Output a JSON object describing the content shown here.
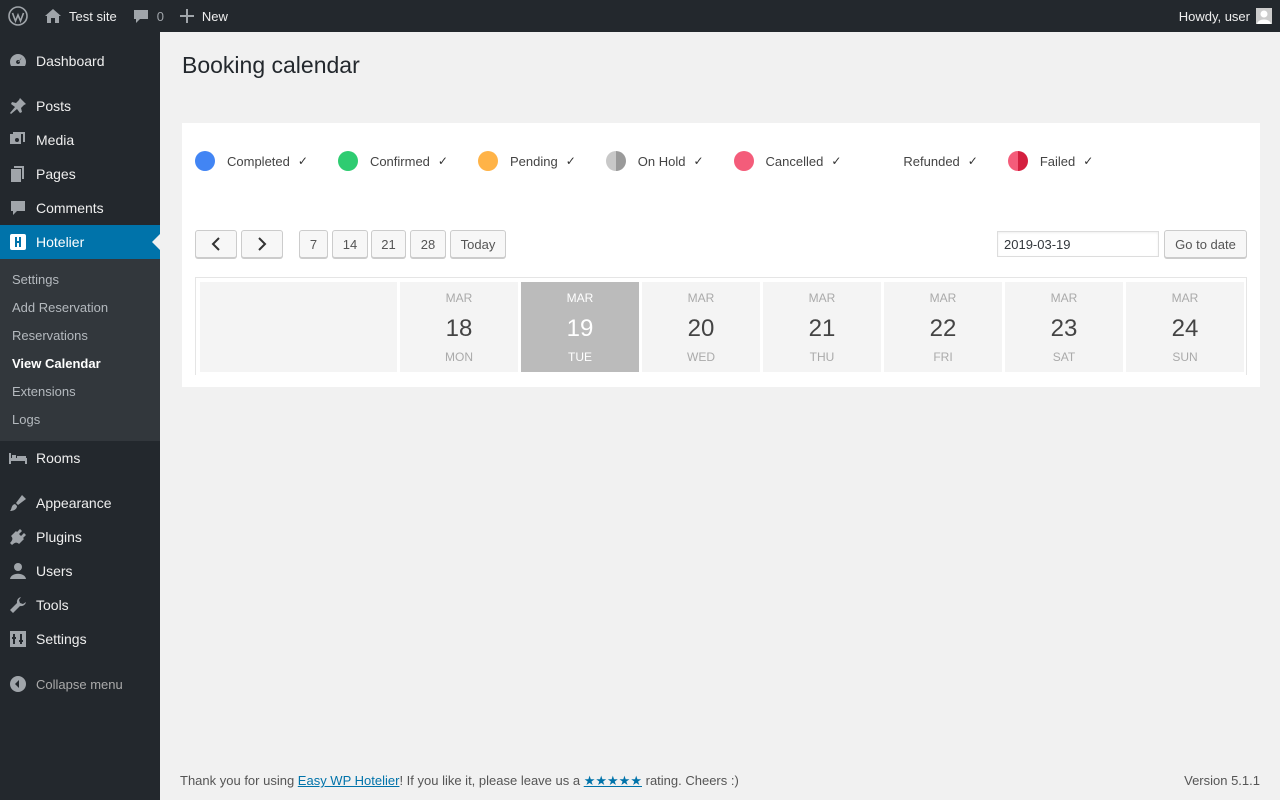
{
  "adminbar": {
    "site_name": "Test site",
    "comments_count": "0",
    "new_label": "New",
    "greeting": "Howdy, user"
  },
  "sidebar": {
    "items": [
      {
        "label": "Dashboard",
        "icon": "dashboard-icon"
      },
      {
        "label": "Posts",
        "icon": "pin-icon"
      },
      {
        "label": "Media",
        "icon": "media-icon"
      },
      {
        "label": "Pages",
        "icon": "pages-icon"
      },
      {
        "label": "Comments",
        "icon": "comment-icon"
      },
      {
        "label": "Hotelier",
        "icon": "hotelier-icon"
      },
      {
        "label": "Rooms",
        "icon": "bed-icon"
      },
      {
        "label": "Appearance",
        "icon": "brush-icon"
      },
      {
        "label": "Plugins",
        "icon": "plug-icon"
      },
      {
        "label": "Users",
        "icon": "user-icon"
      },
      {
        "label": "Tools",
        "icon": "wrench-icon"
      },
      {
        "label": "Settings",
        "icon": "settings-icon"
      }
    ],
    "submenu": [
      "Settings",
      "Add Reservation",
      "Reservations",
      "View Calendar",
      "Extensions",
      "Logs"
    ],
    "collapse_label": "Collapse menu"
  },
  "page": {
    "title": "Booking calendar"
  },
  "legend": [
    {
      "label": "Completed",
      "color": "#4285f4",
      "type": "solid",
      "check": "✓"
    },
    {
      "label": "Confirmed",
      "color": "#2ecc71",
      "type": "solid",
      "check": "✓"
    },
    {
      "label": "Pending",
      "color": "#ffb347",
      "type": "solid",
      "check": "✓"
    },
    {
      "label": "On Hold",
      "color": "#a6a6a6",
      "type": "half",
      "check": "✓"
    },
    {
      "label": "Cancelled",
      "color": "#f45c7a",
      "type": "solid",
      "check": "✓"
    },
    {
      "label": "Refunded",
      "color": "",
      "type": "none",
      "check": "✓"
    },
    {
      "label": "Failed",
      "color": "#f0264c",
      "type": "half-red",
      "check": "✓"
    }
  ],
  "toolbar": {
    "ranges": [
      "7",
      "14",
      "21",
      "28"
    ],
    "today_label": "Today",
    "date_value": "2019-03-19",
    "goto_label": "Go to date"
  },
  "calendar": {
    "days": [
      {
        "month": "MAR",
        "day": "18",
        "weekday": "MON",
        "today": false
      },
      {
        "month": "MAR",
        "day": "19",
        "weekday": "TUE",
        "today": true
      },
      {
        "month": "MAR",
        "day": "20",
        "weekday": "WED",
        "today": false
      },
      {
        "month": "MAR",
        "day": "21",
        "weekday": "THU",
        "today": false
      },
      {
        "month": "MAR",
        "day": "22",
        "weekday": "FRI",
        "today": false
      },
      {
        "month": "MAR",
        "day": "23",
        "weekday": "SAT",
        "today": false
      },
      {
        "month": "MAR",
        "day": "24",
        "weekday": "SUN",
        "today": false
      }
    ]
  },
  "footer": {
    "text_before": "Thank you for using ",
    "link_text": "Easy WP Hotelier",
    "text_middle": "! If you like it, please leave us a ",
    "stars": "★★★★★",
    "text_after": " rating. Cheers :)",
    "version": "Version 5.1.1"
  }
}
